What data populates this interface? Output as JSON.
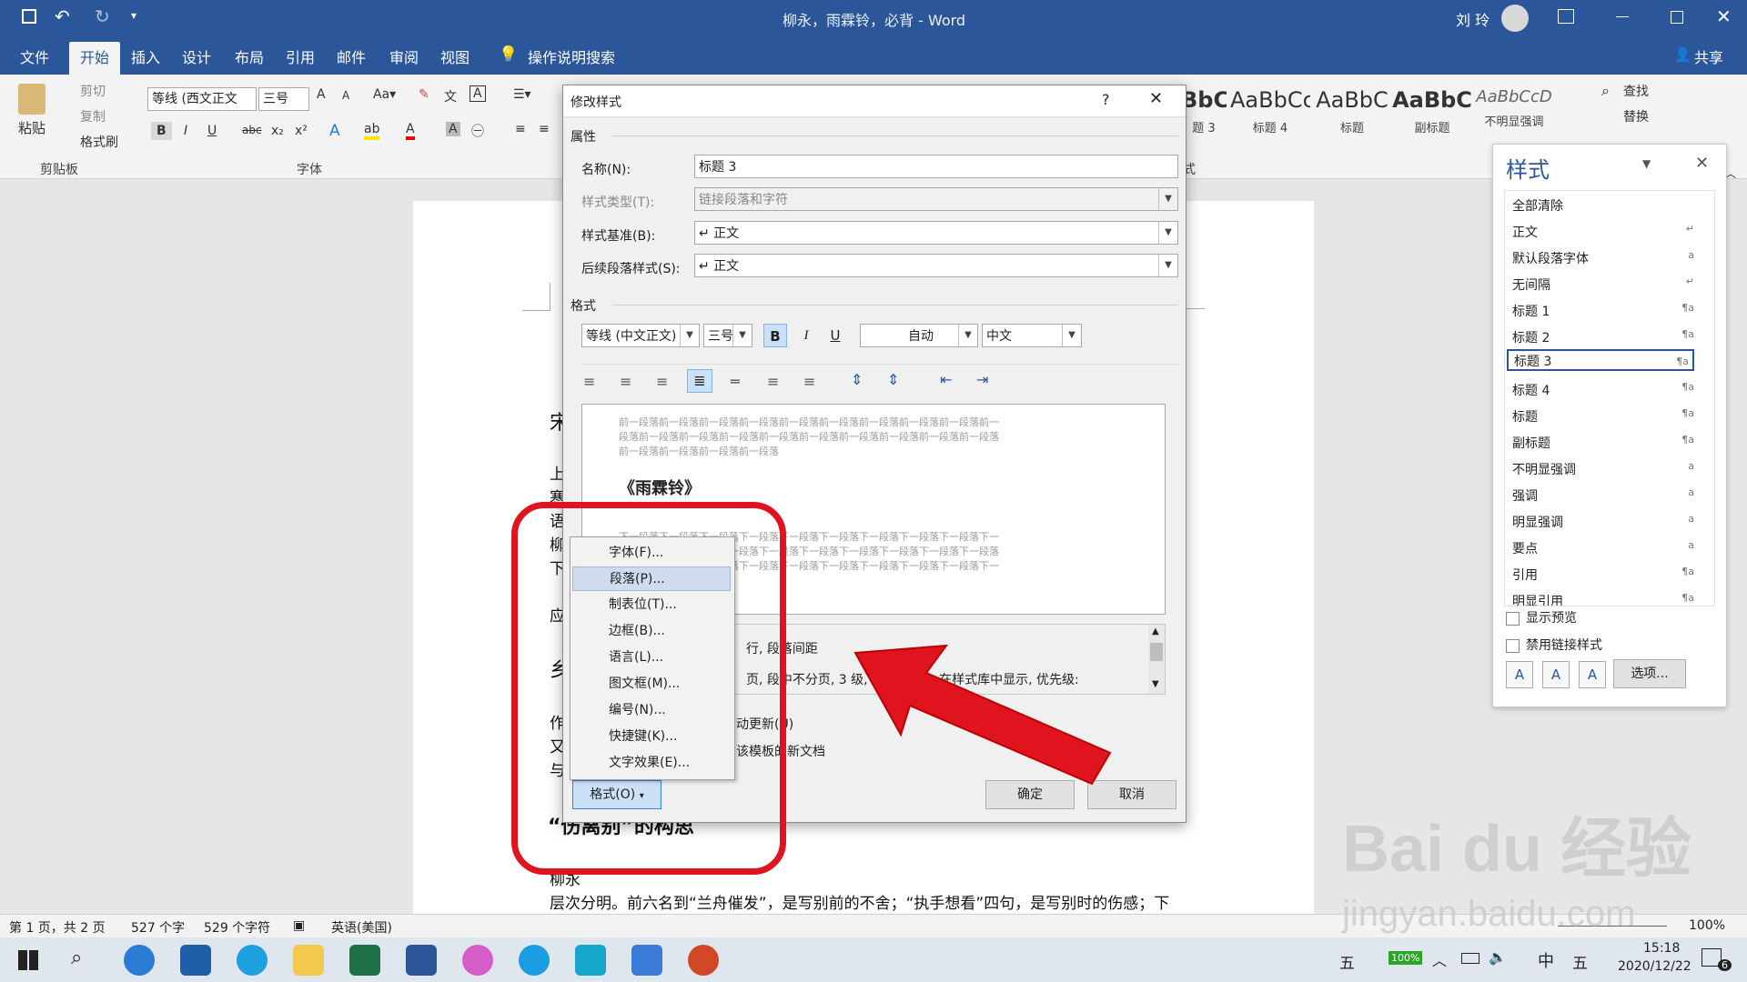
{
  "window": {
    "title": "柳永，雨霖铃，必背  -  Word",
    "user": "刘 玲"
  },
  "tabs": [
    "文件",
    "开始",
    "插入",
    "设计",
    "布局",
    "引用",
    "邮件",
    "审阅",
    "视图"
  ],
  "tell_me": "操作说明搜索",
  "share": "共享",
  "ribbon": {
    "clipboard": {
      "paste": "粘贴",
      "cut": "剪切",
      "copy": "复制",
      "format_painter": "格式刷",
      "label": "剪贴板"
    },
    "font": {
      "font_name": "等线 (西文正文",
      "font_size": "三号",
      "label": "字体",
      "bold": "B",
      "italic": "I",
      "underline": "U",
      "strike": "abc",
      "sub": "x₂",
      "sup": "x²"
    },
    "styles_gallery": [
      {
        "preview": "BbC",
        "name": "题 3"
      },
      {
        "preview": "AaBbCc",
        "name": "标题 4"
      },
      {
        "preview": "AaBbC",
        "name": "标题"
      },
      {
        "preview": "AaBbC",
        "name": "副标题"
      },
      {
        "preview": "AaBbCcD",
        "name": "不明显强调"
      }
    ],
    "editing": {
      "find": "查找",
      "replace": "替换"
    },
    "styles_label": "式"
  },
  "styles_pane": {
    "title": "样式",
    "items": [
      {
        "name": "全部清除",
        "mark": ""
      },
      {
        "name": "正文",
        "mark": "↵"
      },
      {
        "name": "默认段落字体",
        "mark": "a"
      },
      {
        "name": "无间隔",
        "mark": "↵"
      },
      {
        "name": "标题 1",
        "mark": "¶a"
      },
      {
        "name": "标题 2",
        "mark": "¶a"
      },
      {
        "name": "标题 3",
        "mark": "¶a"
      },
      {
        "name": "标题 4",
        "mark": "¶a"
      },
      {
        "name": "标题",
        "mark": "¶a"
      },
      {
        "name": "副标题",
        "mark": "¶a"
      },
      {
        "name": "不明显强调",
        "mark": "a"
      },
      {
        "name": "强调",
        "mark": "a"
      },
      {
        "name": "明显强调",
        "mark": "a"
      },
      {
        "name": "要点",
        "mark": "a"
      },
      {
        "name": "引用",
        "mark": "¶a"
      },
      {
        "name": "明显引用",
        "mark": "¶a"
      }
    ],
    "show_preview": "显示预览",
    "disable_linked": "禁用链接样式",
    "options_button": "选项..."
  },
  "dialog": {
    "title": "修改样式",
    "help": "?",
    "properties_label": "属性",
    "name_label": "名称(N):",
    "name_value": "标题 3",
    "type_label": "样式类型(T):",
    "type_value": "链接段落和字符",
    "based_label": "样式基准(B):",
    "based_value": "↵ 正文",
    "next_label": "后续段落样式(S):",
    "next_value": "↵ 正文",
    "format_label": "格式",
    "font_name": "等线 (中文正文)",
    "font_size": "三号",
    "color": "自动",
    "lang": "中文",
    "preview_prev": [
      "前一段落前一段落前一段落前一段落前一段落前一段落前一段落前一段落前一段落前一",
      "段落前一段落前一段落前一段落前一段落前一段落前一段落前一段落前一段落前一段落",
      "前一段落前一段落前一段落前一段落"
    ],
    "preview_title": "《雨霖铃》",
    "preview_next": [
      "下一段落下一段落下一段落下一段落下一段落下一段落下一段落下一段落下一段落下一",
      "段落下一段落下一段落下一段落下一段落下一段落下一段落下一段落下一段落下一段落",
      "下一段落下一段落下一段落下一段落下一段落下一段落下一段落下一段落下一段落下一"
    ],
    "desc_line1": "行, 段落间距",
    "desc_line2": "页, 段中不分页, 3 级, 样式: 链接, 在样式库中显示, 优先级:",
    "desc_line2b": "在样式库中显示, 优先级:",
    "auto_update": "动更新(U)",
    "new_docs": "该模板的新文档",
    "format_button": "格式(O)",
    "ok": "确定",
    "cancel": "取消"
  },
  "format_menu": [
    "字体(F)...",
    "段落(P)...",
    "制表位(T)...",
    "边框(B)...",
    "语言(L)...",
    "图文框(M)...",
    "编号(N)...",
    "快捷键(K)...",
    "文字效果(E)..."
  ],
  "document": {
    "left_chars": [
      "宋",
      "上",
      "寒",
      "语",
      "柳",
      "下",
      "应",
      "乡",
      "作",
      "又",
      "与"
    ],
    "heading": "“伤离别”的构思",
    "line_a": "柳永",
    "line_b": "层次分明。前六名到“兰舟催发”，是写别前的不舍；“执手想看”四句，是写别时的伤感；下"
  },
  "status": {
    "page": "第 1 页，共 2 页",
    "words": "527 个字",
    "chars": "529 个字符",
    "lang": "英语(美国)",
    "zoom": "100%"
  },
  "taskbar": {
    "ime": "五",
    "battery": "100%",
    "lang": "中",
    "ime2": "五",
    "time": "15:18",
    "date": "2020/12/22",
    "notif": "6"
  },
  "watermark": {
    "brand": "Bai du 经验",
    "url": "jingyan.baidu.com"
  },
  "colors": {
    "word_blue": "#2b579a",
    "annotation_red": "#e0141e"
  }
}
